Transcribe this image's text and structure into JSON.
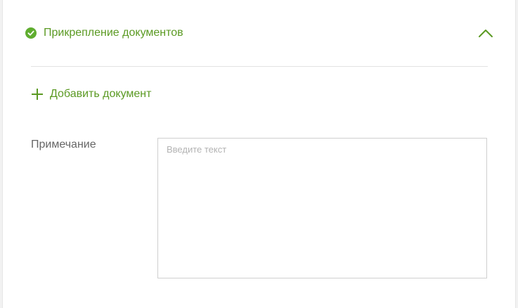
{
  "section": {
    "title": "Прикрепление документов",
    "status_icon": "check-circle-icon",
    "collapse_icon": "chevron-up-icon",
    "expanded": true,
    "accent_color": "#5b9a23"
  },
  "add_document": {
    "label": "Добавить документ",
    "icon": "plus-icon"
  },
  "note": {
    "label": "Примечание",
    "value": "",
    "placeholder": "Введите текст"
  }
}
